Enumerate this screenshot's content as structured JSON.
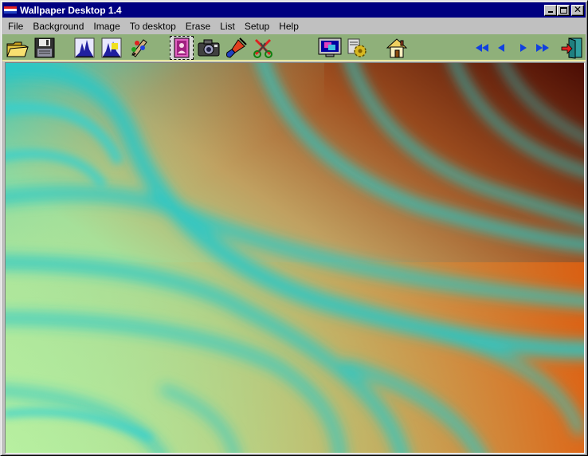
{
  "window": {
    "title": "Wallpaper Desktop 1.4"
  },
  "title_buttons": {
    "minimize_icon": "minimize-icon",
    "maximize_icon": "maximize-icon",
    "close_label": "✕"
  },
  "menu": {
    "items": [
      "File",
      "Background",
      "Image",
      "To desktop",
      "Erase",
      "List",
      "Setup",
      "Help"
    ]
  },
  "toolbar": {
    "tools": [
      "open-folder-icon",
      "save-disk-icon",
      "histogram-icon",
      "histogram-adjust-icon",
      "paint-palette-icon",
      "portrait-frame-icon",
      "camera-icon",
      "paint-brush-icon",
      "cut-clear-icon",
      "monitor-icon",
      "settings-gear-icon",
      "home-icon",
      "first-icon",
      "previous-icon",
      "next-icon",
      "last-icon",
      "exit-door-icon"
    ],
    "background_color": "#8fb07a"
  },
  "wallpaper": {
    "description_colors": {
      "light_green": "#a8e8a0",
      "cyan": "#30c8c8",
      "brown": "#8a3a10",
      "orange": "#d86010",
      "dark_maroon": "#4a1008"
    }
  }
}
